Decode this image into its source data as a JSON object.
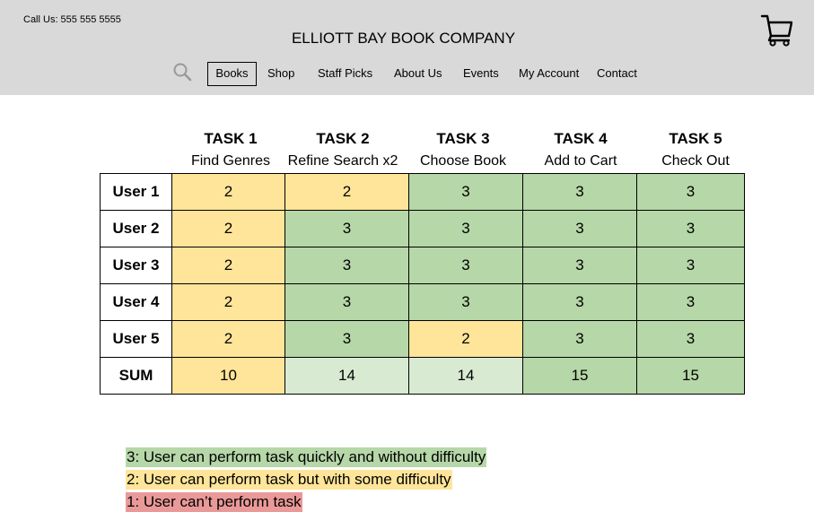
{
  "header": {
    "phone": "Call Us: 555 555 5555",
    "brand": "ELLIOTT BAY BOOK COMPANY",
    "nav": [
      "Books",
      "Shop",
      "Staff Picks",
      "About Us",
      "Events",
      "My Account",
      "Contact"
    ],
    "active_nav": "Books"
  },
  "table": {
    "tasks": [
      {
        "title": "TASK 1",
        "subtitle": "Find Genres"
      },
      {
        "title": "TASK 2",
        "subtitle": "Refine Search x2"
      },
      {
        "title": "TASK 3",
        "subtitle": "Choose Book"
      },
      {
        "title": "TASK 4",
        "subtitle": "Add to Cart"
      },
      {
        "title": "TASK 5",
        "subtitle": "Check Out"
      }
    ],
    "rows": [
      {
        "label": "User 1",
        "values": [
          "2",
          "2",
          "3",
          "3",
          "3"
        ]
      },
      {
        "label": "User 2",
        "values": [
          "2",
          "3",
          "3",
          "3",
          "3"
        ]
      },
      {
        "label": "User 3",
        "values": [
          "2",
          "3",
          "3",
          "3",
          "3"
        ]
      },
      {
        "label": "User 4",
        "values": [
          "2",
          "3",
          "3",
          "3",
          "3"
        ]
      },
      {
        "label": "User 5",
        "values": [
          "2",
          "3",
          "2",
          "3",
          "3"
        ]
      },
      {
        "label": "SUM",
        "values": [
          "10",
          "14",
          "14",
          "15",
          "15"
        ]
      }
    ]
  },
  "legend": [
    {
      "text": "3: User can perform task quickly and without difficulty",
      "color": "#b6d7a8"
    },
    {
      "text": "2: User can perform task but with some difficulty",
      "color": "#ffe599"
    },
    {
      "text": "1: User can’t perform task",
      "color": "#ea9999"
    }
  ],
  "colors": {
    "header_bg": "#d9d9d9",
    "score_3": "#b6d7a8",
    "score_2": "#ffe599",
    "score_1": "#ea9999",
    "sum_light": "#d9ead3"
  },
  "icons": {
    "search": "search-icon",
    "cart": "cart-icon"
  }
}
